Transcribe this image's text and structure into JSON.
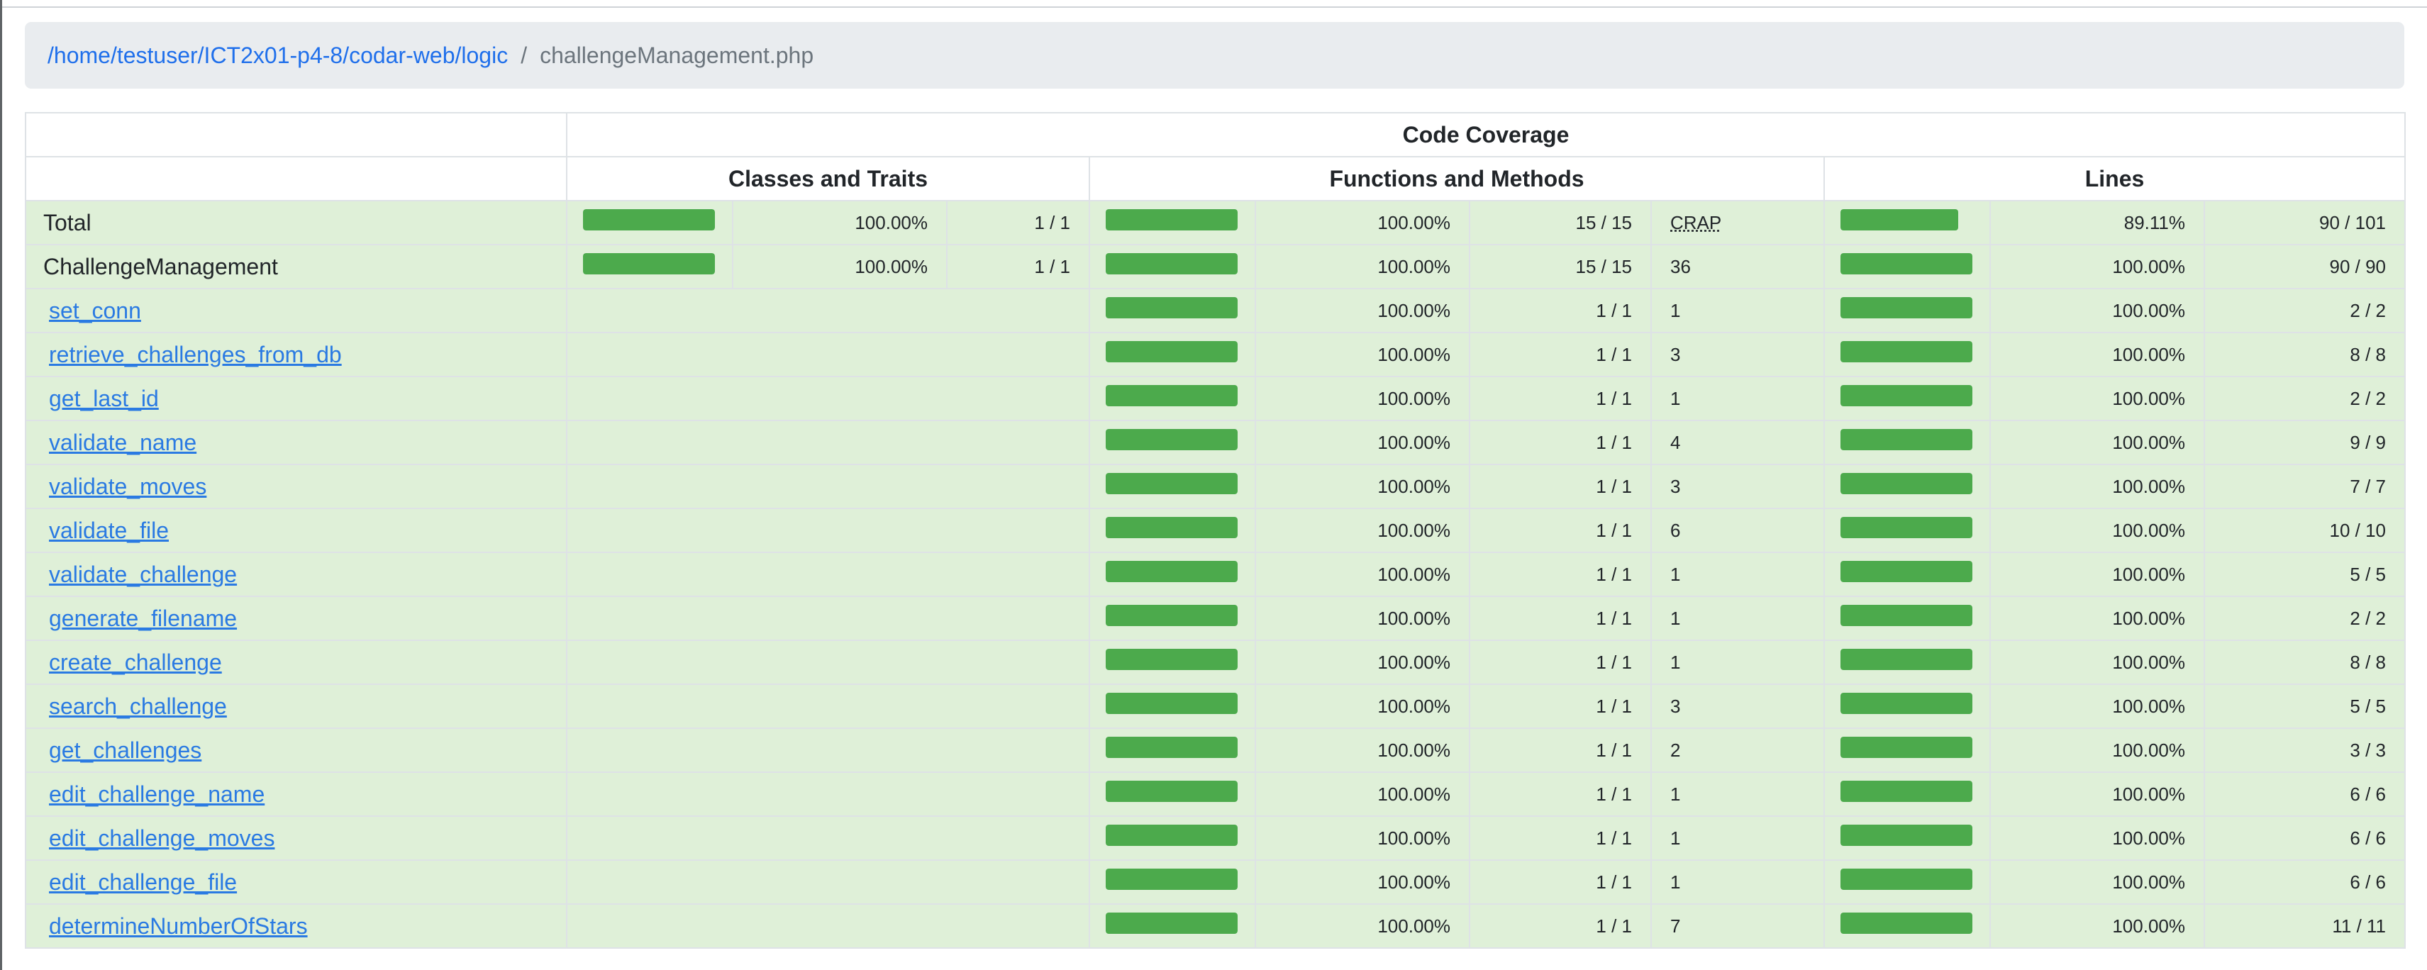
{
  "breadcrumb": {
    "path": "/home/testuser/ICT2x01-p4-8/codar-web/logic",
    "separator": "/",
    "file": "challengeManagement.php"
  },
  "header": {
    "title": "Code Coverage",
    "classes": "Classes and Traits",
    "functions": "Functions and Methods",
    "lines": "Lines",
    "crap": "CRAP"
  },
  "colors": {
    "row_success": "#dff0d8",
    "bar": "#4caa4c",
    "link": "#2a7ae2"
  },
  "total": {
    "name": "Total",
    "classes_pct": "100.00%",
    "classes_ratio": "1 / 1",
    "classes_fill": 1.0,
    "functions_pct": "100.00%",
    "functions_ratio": "15 / 15",
    "functions_fill": 1.0,
    "lines_pct": "89.11%",
    "lines_ratio": "90 / 101",
    "lines_fill": 0.8911
  },
  "class": {
    "name": "ChallengeManagement",
    "classes_pct": "100.00%",
    "classes_ratio": "1 / 1",
    "classes_fill": 1.0,
    "functions_pct": "100.00%",
    "functions_ratio": "15 / 15",
    "functions_fill": 1.0,
    "crap": "36",
    "lines_pct": "100.00%",
    "lines_ratio": "90 / 90",
    "lines_fill": 1.0
  },
  "methods": [
    {
      "name": "set_conn",
      "fn_pct": "100.00%",
      "fn_ratio": "1 / 1",
      "crap": "1",
      "ln_pct": "100.00%",
      "ln_ratio": "2 / 2"
    },
    {
      "name": "retrieve_challenges_from_db",
      "fn_pct": "100.00%",
      "fn_ratio": "1 / 1",
      "crap": "3",
      "ln_pct": "100.00%",
      "ln_ratio": "8 / 8"
    },
    {
      "name": "get_last_id",
      "fn_pct": "100.00%",
      "fn_ratio": "1 / 1",
      "crap": "1",
      "ln_pct": "100.00%",
      "ln_ratio": "2 / 2"
    },
    {
      "name": "validate_name",
      "fn_pct": "100.00%",
      "fn_ratio": "1 / 1",
      "crap": "4",
      "ln_pct": "100.00%",
      "ln_ratio": "9 / 9"
    },
    {
      "name": "validate_moves",
      "fn_pct": "100.00%",
      "fn_ratio": "1 / 1",
      "crap": "3",
      "ln_pct": "100.00%",
      "ln_ratio": "7 / 7"
    },
    {
      "name": "validate_file",
      "fn_pct": "100.00%",
      "fn_ratio": "1 / 1",
      "crap": "6",
      "ln_pct": "100.00%",
      "ln_ratio": "10 / 10"
    },
    {
      "name": "validate_challenge",
      "fn_pct": "100.00%",
      "fn_ratio": "1 / 1",
      "crap": "1",
      "ln_pct": "100.00%",
      "ln_ratio": "5 / 5"
    },
    {
      "name": "generate_filename",
      "fn_pct": "100.00%",
      "fn_ratio": "1 / 1",
      "crap": "1",
      "ln_pct": "100.00%",
      "ln_ratio": "2 / 2"
    },
    {
      "name": "create_challenge",
      "fn_pct": "100.00%",
      "fn_ratio": "1 / 1",
      "crap": "1",
      "ln_pct": "100.00%",
      "ln_ratio": "8 / 8"
    },
    {
      "name": "search_challenge",
      "fn_pct": "100.00%",
      "fn_ratio": "1 / 1",
      "crap": "3",
      "ln_pct": "100.00%",
      "ln_ratio": "5 / 5"
    },
    {
      "name": "get_challenges",
      "fn_pct": "100.00%",
      "fn_ratio": "1 / 1",
      "crap": "2",
      "ln_pct": "100.00%",
      "ln_ratio": "3 / 3"
    },
    {
      "name": "edit_challenge_name",
      "fn_pct": "100.00%",
      "fn_ratio": "1 / 1",
      "crap": "1",
      "ln_pct": "100.00%",
      "ln_ratio": "6 / 6"
    },
    {
      "name": "edit_challenge_moves",
      "fn_pct": "100.00%",
      "fn_ratio": "1 / 1",
      "crap": "1",
      "ln_pct": "100.00%",
      "ln_ratio": "6 / 6"
    },
    {
      "name": "edit_challenge_file",
      "fn_pct": "100.00%",
      "fn_ratio": "1 / 1",
      "crap": "1",
      "ln_pct": "100.00%",
      "ln_ratio": "6 / 6"
    },
    {
      "name": "determineNumberOfStars",
      "fn_pct": "100.00%",
      "fn_ratio": "1 / 1",
      "crap": "7",
      "ln_pct": "100.00%",
      "ln_ratio": "11 / 11"
    }
  ]
}
